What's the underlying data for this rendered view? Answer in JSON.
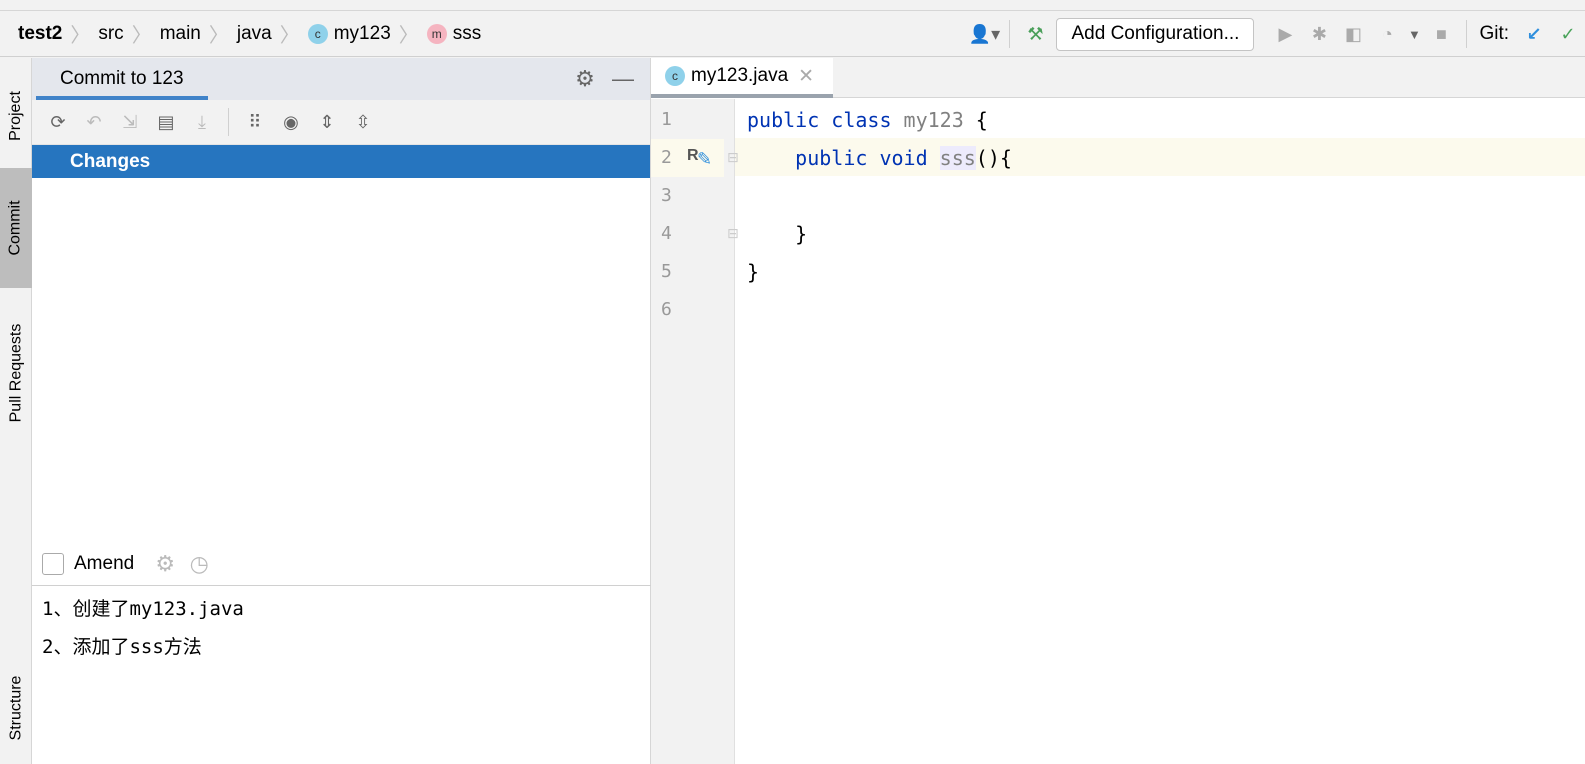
{
  "breadcrumb": [
    {
      "label": "test2"
    },
    {
      "label": "src"
    },
    {
      "label": "main"
    },
    {
      "label": "java"
    },
    {
      "label": "my123",
      "badge": "c"
    },
    {
      "label": "sss",
      "badge": "m"
    }
  ],
  "toolbar": {
    "add_configuration": "Add Configuration...",
    "git_label": "Git:"
  },
  "left_stripe": {
    "project": "Project",
    "commit": "Commit",
    "pull_requests": "Pull Requests",
    "structure": "Structure"
  },
  "commit_panel": {
    "tab": "Commit to 123",
    "changes": "Changes",
    "amend": "Amend",
    "message": [
      "1、创建了my123.java",
      "2、添加了sss方法"
    ]
  },
  "editor": {
    "tab": "my123.java",
    "tab_badge": "c",
    "gutter_marker": "R",
    "lines": [
      {
        "n": "1"
      },
      {
        "n": "2"
      },
      {
        "n": "3"
      },
      {
        "n": "4"
      },
      {
        "n": "5"
      },
      {
        "n": "6"
      }
    ],
    "code": {
      "l1_kw": "public class",
      "l1_name": "my123",
      "l1_rest": " {",
      "l2_kw": "public void",
      "l2_name": "sss",
      "l2_rest": "(){",
      "l4": "}",
      "l5": "}"
    }
  },
  "colors": {
    "accent": "#2675bf",
    "keyword": "#0033b3",
    "class_badge": "#8fd1ea",
    "method_badge": "#f5b4c0",
    "build_green": "#4a9f5a",
    "git_update": "#2f8fdd",
    "git_commit": "#49a35a"
  }
}
